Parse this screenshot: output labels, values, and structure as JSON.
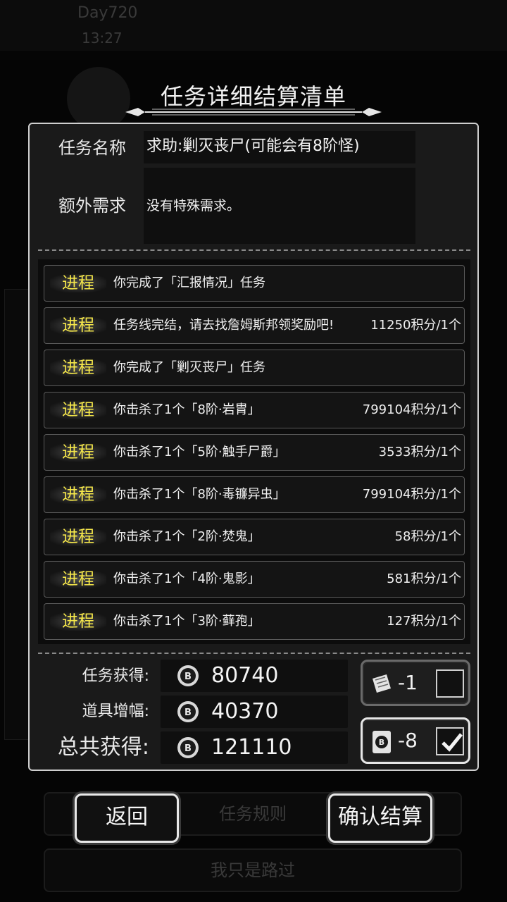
{
  "background": {
    "day_label": "Day720",
    "time_label": "13:27",
    "rules_button": "任务规则",
    "pass_button": "我只是路过"
  },
  "dialog": {
    "title": "任务详细结算清单",
    "task_name_label": "任务名称",
    "task_name_value": "求助:剿灭丧尸(可能会有8阶怪)",
    "extra_req_label": "额外需求",
    "extra_req_value": "没有特殊需求。",
    "rows": [
      {
        "tag": "进程",
        "text": "你完成了「汇报情况」任务",
        "reward": ""
      },
      {
        "tag": "进程",
        "text": "任务线完结，请去找詹姆斯邦领奖励吧!",
        "reward": "11250积分/1个"
      },
      {
        "tag": "进程",
        "text": "你完成了「剿灭丧尸」任务",
        "reward": ""
      },
      {
        "tag": "进程",
        "text": "你击杀了1个「8阶·岩胄」",
        "reward": "799104积分/1个"
      },
      {
        "tag": "进程",
        "text": "你击杀了1个「5阶·触手尸爵」",
        "reward": "3533积分/1个"
      },
      {
        "tag": "进程",
        "text": "你击杀了1个「8阶·毒镰异虫」",
        "reward": "799104积分/1个"
      },
      {
        "tag": "进程",
        "text": "你击杀了1个「2阶·焚鬼」",
        "reward": "58积分/1个"
      },
      {
        "tag": "进程",
        "text": "你击杀了1个「4阶·鬼影」",
        "reward": "581积分/1个"
      },
      {
        "tag": "进程",
        "text": "你击杀了1个「3阶·藓孢」",
        "reward": "127积分/1个"
      }
    ],
    "summary": {
      "task_gain_label": "任务获得:",
      "task_gain_value": "80740",
      "item_bonus_label": "道具增幅:",
      "item_bonus_value": "40370",
      "total_label": "总共获得:",
      "total_value": "121110"
    },
    "items": [
      {
        "icon": "scroll-icon",
        "count": "-1",
        "checked": false
      },
      {
        "icon": "coin-card-icon",
        "count": "-8",
        "checked": true
      }
    ],
    "back_button": "返回",
    "confirm_button": "确认结算"
  },
  "colors": {
    "tag_yellow": "#f6e84a",
    "frame": "#cfcfcf"
  }
}
